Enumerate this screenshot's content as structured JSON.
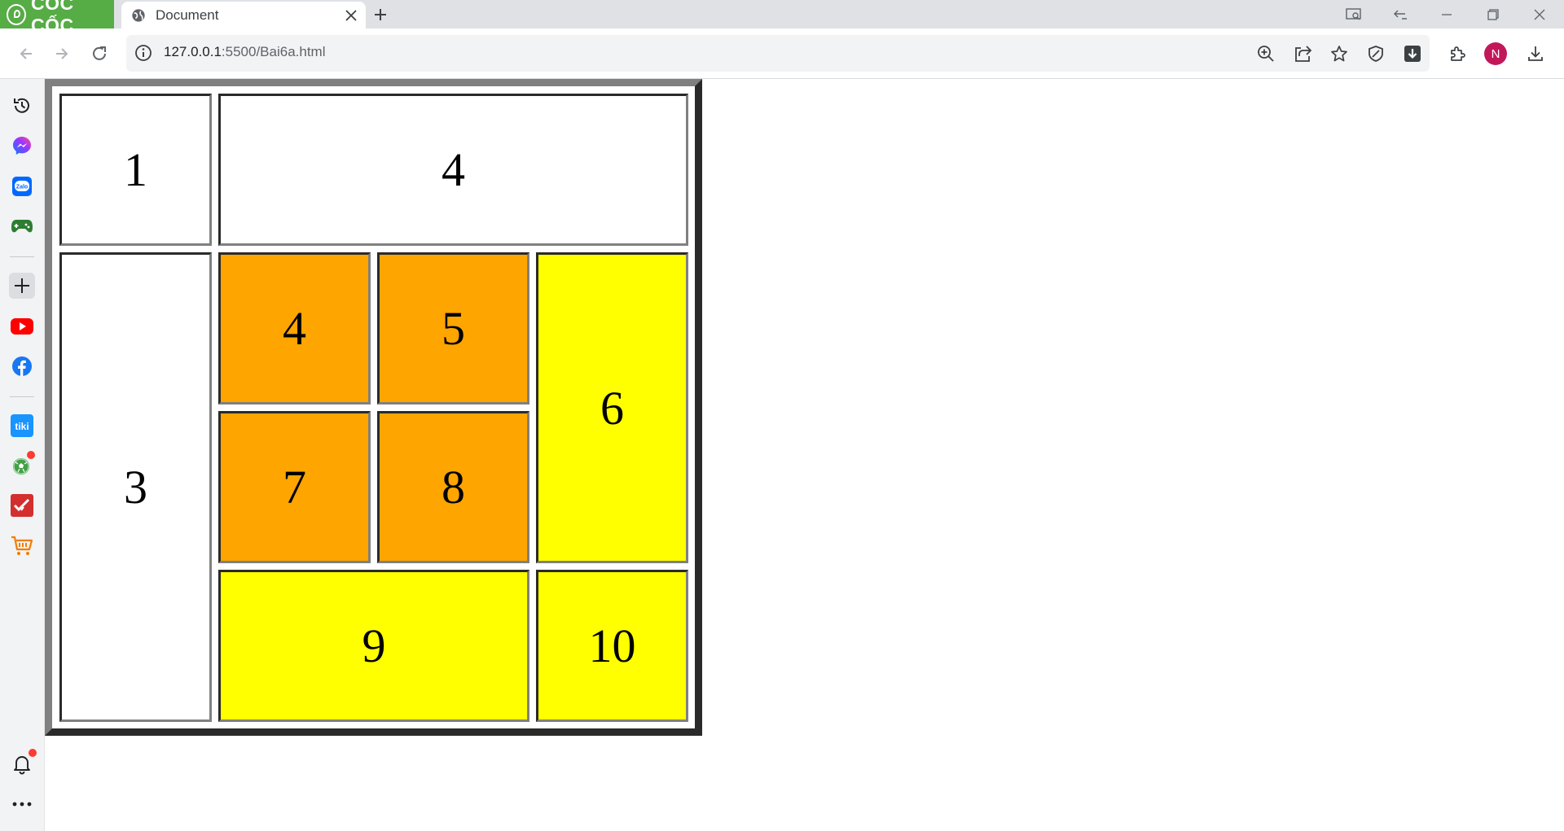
{
  "browser": {
    "brand": "CỐC CỐC",
    "tab_title": "Document",
    "url_host": "127.0.0.1",
    "url_rest": ":5500/Bai6a.html",
    "profile_initial": "N"
  },
  "sidebar": {
    "items": [
      "history-icon",
      "messenger-icon",
      "zalo-icon",
      "game-icon",
      "add-icon",
      "youtube-icon",
      "facebook-icon",
      "tiki-icon",
      "football-icon",
      "todo-icon",
      "cart-icon"
    ],
    "zalo_label": "Zalo",
    "tiki_label": "tiki"
  },
  "table": {
    "cells": [
      {
        "label": "1",
        "bg": "#ffffff"
      },
      {
        "label": "4",
        "bg": "#ffffff"
      },
      {
        "label": "3",
        "bg": "#ffffff"
      },
      {
        "label": "4",
        "bg": "#ffa500"
      },
      {
        "label": "5",
        "bg": "#ffa500"
      },
      {
        "label": "6",
        "bg": "#ffff00"
      },
      {
        "label": "7",
        "bg": "#ffa500"
      },
      {
        "label": "8",
        "bg": "#ffa500"
      },
      {
        "label": "9",
        "bg": "#ffff00"
      },
      {
        "label": "10",
        "bg": "#ffff00"
      }
    ]
  },
  "colors": {
    "brand_green": "#56ac45",
    "orange": "#ffa500",
    "yellow": "#ffff00",
    "avatar": "#c2185b"
  }
}
